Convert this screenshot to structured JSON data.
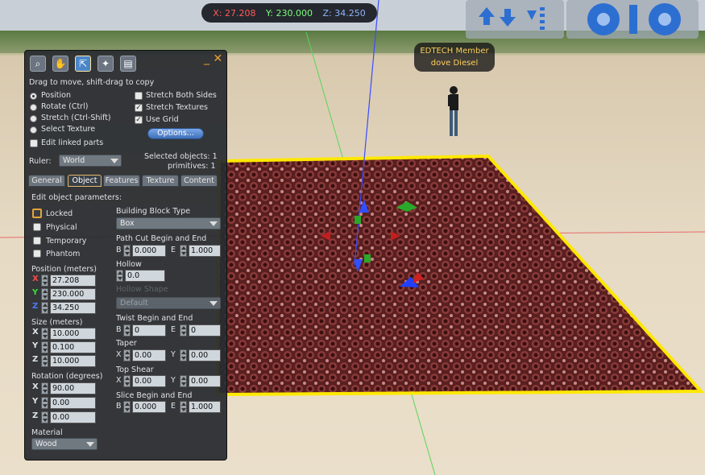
{
  "hud": {
    "x": "X: 27.208",
    "y": "Y: 230.000",
    "z": "Z: 34.250"
  },
  "nametag": {
    "group": "EDTECH Member",
    "name": "dove Diesel"
  },
  "panel": {
    "hint": "Drag to move, shift-drag to copy",
    "modes": [
      "Position",
      "Rotate (Ctrl)",
      "Stretch (Ctrl-Shift)",
      "Select Texture"
    ],
    "edit_linked": "Edit linked parts",
    "options_right": [
      "Stretch Both Sides",
      "Stretch Textures",
      "Use Grid"
    ],
    "options_button": "Options...",
    "ruler_label": "Ruler:",
    "ruler_value": "World",
    "selected_objects": "Selected objects: 1",
    "primitives": "primitives: 1",
    "tabs": [
      "General",
      "Object",
      "Features",
      "Texture",
      "Content"
    ],
    "active_tab": "Object",
    "edit_params": "Edit object parameters:",
    "flags": [
      "Locked",
      "Physical",
      "Temporary",
      "Phantom"
    ],
    "position_label": "Position (meters)",
    "position": [
      "27.208",
      "230.000",
      "34.250"
    ],
    "size_label": "Size (meters)",
    "size": [
      "10.000",
      "0.100",
      "10.000"
    ],
    "rotation_label": "Rotation (degrees)",
    "rotation": [
      "90.00",
      "0.00",
      "0.00"
    ],
    "material_label": "Material",
    "material_value": "Wood",
    "axis_letters": [
      "X",
      "Y",
      "Z"
    ],
    "building_block_label": "Building Block Type",
    "building_block_value": "Box",
    "path_cut_label": "Path Cut Begin and End",
    "path_cut_b": "0.000",
    "path_cut_e": "1.000",
    "hollow_label": "Hollow",
    "hollow_value": "0.0",
    "hollow_shape_label": "Hollow Shape",
    "hollow_shape_value": "Default",
    "twist_label": "Twist Begin and End",
    "twist_b": "0",
    "twist_e": "0",
    "taper_label": "Taper",
    "taper_x": "0.00",
    "taper_y": "0.00",
    "top_shear_label": "Top Shear",
    "top_shear_x": "0.00",
    "top_shear_y": "0.00",
    "slice_label": "Slice Begin and End",
    "slice_b": "0.000",
    "slice_e": "1.000",
    "b_letter": "B",
    "e_letter": "E",
    "x_letter": "X",
    "y_letter": "Y",
    "window_controls": "_ ✕"
  },
  "colors": {
    "x_axis": "#ff4444",
    "y_axis": "#3ddc3d",
    "z_axis": "#4a7cff",
    "highlight": "#ffe800"
  }
}
